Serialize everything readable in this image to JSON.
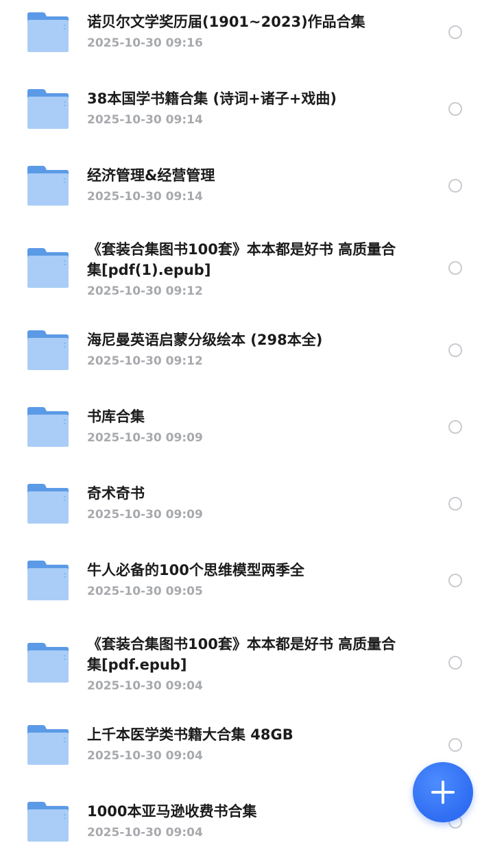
{
  "files": [
    {
      "name": "诺贝尔文学奖历届(1901~2023)作品合集",
      "date": "2025-10-30 09:16"
    },
    {
      "name": "38本国学书籍合集 (诗词+诸子+戏曲)",
      "date": "2025-10-30 09:14"
    },
    {
      "name": "经济管理&经营管理",
      "date": "2025-10-30 09:14"
    },
    {
      "name": "《套装合集图书100套》本本都是好书 高质量合集[pdf(1).epub]",
      "date": "2025-10-30 09:12"
    },
    {
      "name": "海尼曼英语启蒙分级绘本 (298本全)",
      "date": "2025-10-30 09:12"
    },
    {
      "name": "书库合集",
      "date": "2025-10-30 09:09"
    },
    {
      "name": "奇术奇书",
      "date": "2025-10-30 09:09"
    },
    {
      "name": "牛人必备的100个思维模型两季全",
      "date": "2025-10-30 09:05"
    },
    {
      "name": "《套装合集图书100套》本本都是好书 高质量合集[pdf.epub]",
      "date": "2025-10-30 09:04"
    },
    {
      "name": "上千本医学类书籍大合集 48GB",
      "date": "2025-10-30 09:04"
    },
    {
      "name": "1000本亚马逊收费书合集",
      "date": "2025-10-30 09:04"
    }
  ],
  "fab": {
    "icon": "plus-icon",
    "color": "#2f6df2"
  },
  "colors": {
    "folder_back": "#5b9ae6",
    "folder_front": "#a9cdf6",
    "title": "#1b1b1b",
    "date": "#a7a9ad"
  }
}
